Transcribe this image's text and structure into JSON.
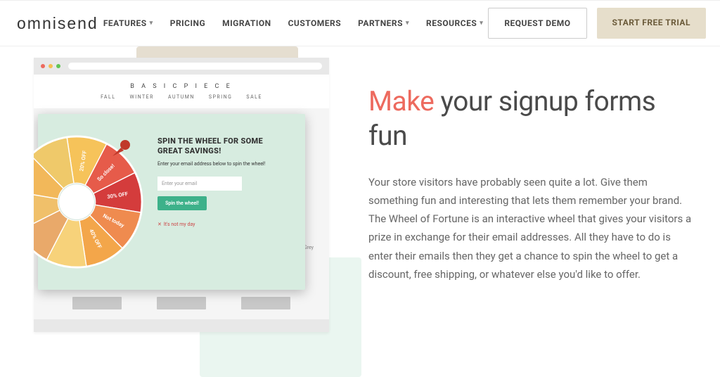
{
  "brand": "omnisend",
  "nav": {
    "features": "FEATURES",
    "pricing": "PRICING",
    "migration": "MIGRATION",
    "customers": "CUSTOMERS",
    "partners": "PARTNERS",
    "resources": "RESOURCES"
  },
  "cta": {
    "demo": "REQUEST DEMO",
    "trial": "START FREE TRIAL"
  },
  "hero": {
    "accent": "Make",
    "rest": " your signup forms fun",
    "body": "Your store visitors have probably seen quite a lot. Give them something fun and interesting that lets them remember your brand. The Wheel of Fortune is an interactive wheel that gives your visitors a prize in exchange for their email addresses. All they have to do is enter their emails then they get a chance to spin the wheel to get a discount, free shipping, or whatever else you'd like to offer."
  },
  "mock_site": {
    "brand": "B A S I C   P I E C E",
    "nav": {
      "fall": "FALL",
      "winter": "WINTER",
      "autumn": "AUTUMN",
      "spring": "SPRING",
      "sale": "SALE"
    },
    "product_label": "Grey"
  },
  "popup": {
    "title": "SPIN THE WHEEL FOR SOME GREAT SAVINGS!",
    "sub": "Enter your email address below to spin the wheel!",
    "placeholder": "Enter your email",
    "button": "Spin the wheel!",
    "skip": "It's not my day"
  },
  "wheel": {
    "segments": [
      {
        "label": "20% OFF",
        "color": "#f6c35a"
      },
      {
        "label": "So close!",
        "color": "#e65b4a"
      },
      {
        "label": "30% OFF",
        "color": "#d43c3c"
      },
      {
        "label": "Not today",
        "color": "#ef8b4f"
      },
      {
        "label": "40% OFF",
        "color": "#f3a64a"
      },
      {
        "label": "",
        "color": "#f7d27a"
      },
      {
        "label": "",
        "color": "#e9a96a"
      },
      {
        "label": "",
        "color": "#f0c06a"
      },
      {
        "label": "",
        "color": "#f2b85a"
      },
      {
        "label": "",
        "color": "#efc96a"
      }
    ]
  }
}
